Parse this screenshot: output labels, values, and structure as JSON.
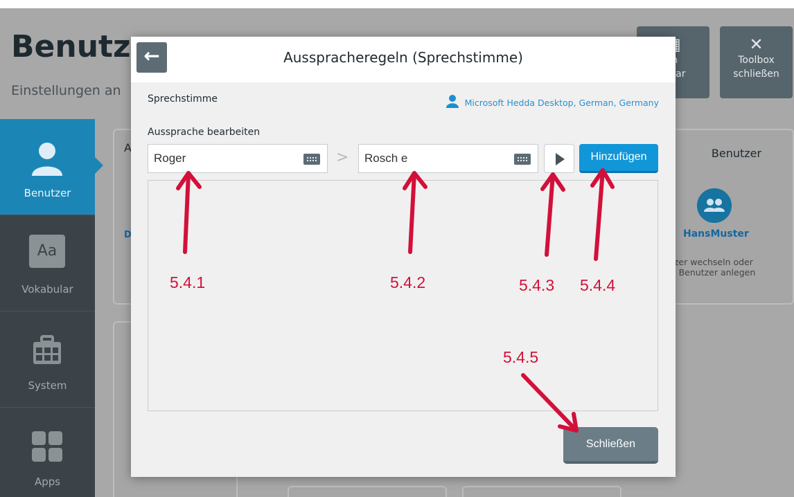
{
  "background": {
    "title": "Benutzer",
    "subtitle": "Einstellungen an",
    "toolbar": {
      "vocab_label_line1": "m",
      "vocab_label_line2": "bular",
      "close_label_line1": "Toolbox",
      "close_label_line2": "schließen"
    },
    "nav": [
      {
        "label": "Benutzer",
        "icon": "user-icon",
        "active": true
      },
      {
        "label": "Vokabular",
        "icon": "aa-icon",
        "glyph": "Aa",
        "active": false
      },
      {
        "label": "System",
        "icon": "toolbox-icon",
        "active": false
      },
      {
        "label": "Apps",
        "icon": "apps-grid-icon",
        "active": false
      }
    ],
    "panel_left": {
      "heading": "A",
      "link": "D"
    },
    "panel_user": {
      "heading": "Benutzer",
      "name": "HansMuster",
      "note_line1": "utzer wechseln oder",
      "note_line2": "en Benutzer anlegen"
    }
  },
  "modal": {
    "title": "Ausspracheregeln (Sprechstimme)",
    "voice_label": "Sprechstimme",
    "voice_value": "Microsoft Hedda Desktop, German, Germany",
    "edit_label": "Aussprache bearbeiten",
    "source_value": "Roger",
    "target_value": "Rosch e",
    "separator": ">",
    "add_label": "Hinzufügen",
    "close_label": "Schließen"
  },
  "annotations": [
    "5.4.1",
    "5.4.2",
    "5.4.3",
    "5.4.4",
    "5.4.5"
  ],
  "colors": {
    "accent": "#1196d8",
    "annotation": "#d3103a",
    "nav_active": "#1b86b6",
    "nav_bg": "#3c4348"
  }
}
